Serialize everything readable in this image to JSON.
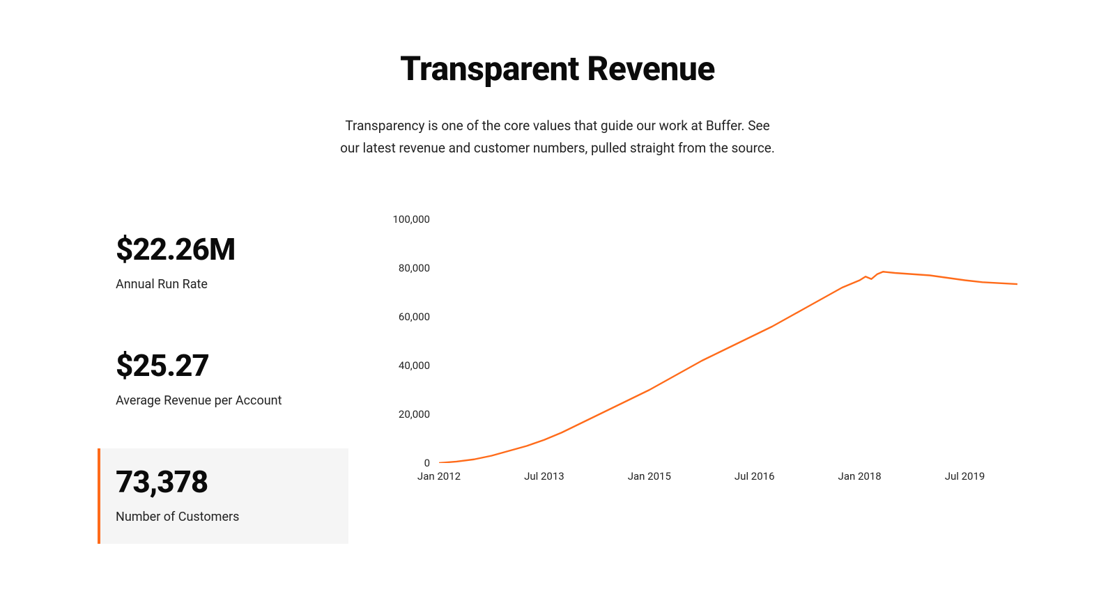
{
  "header": {
    "title": "Transparent Revenue",
    "subtitle": "Transparency is one of the core values that guide our work at Buffer. See our latest revenue and customer numbers, pulled straight from the source."
  },
  "stats": {
    "arr": {
      "value": "$22.26M",
      "label": "Annual Run Rate"
    },
    "arpa": {
      "value": "$25.27",
      "label": "Average Revenue per Account"
    },
    "customers": {
      "value": "73,378",
      "label": "Number of Customers"
    }
  },
  "accent_color": "#ff6b1a",
  "chart_data": {
    "type": "line",
    "title": "",
    "xlabel": "",
    "ylabel": "",
    "ylim": [
      0,
      100000
    ],
    "y_ticks": [
      "0",
      "20,000",
      "40,000",
      "60,000",
      "80,000",
      "100,000"
    ],
    "x_ticks": [
      "Jan 2012",
      "Jul 2013",
      "Jan 2015",
      "Jul 2016",
      "Jan 2018",
      "Jul 2019"
    ],
    "series": [
      {
        "name": "Number of Customers",
        "color": "#ff6b1a",
        "points": [
          {
            "x": "Jan 2012",
            "y": 0
          },
          {
            "x": "Apr 2012",
            "y": 600
          },
          {
            "x": "Jul 2012",
            "y": 1500
          },
          {
            "x": "Oct 2012",
            "y": 3000
          },
          {
            "x": "Jan 2013",
            "y": 5000
          },
          {
            "x": "Apr 2013",
            "y": 7000
          },
          {
            "x": "Jul 2013",
            "y": 9500
          },
          {
            "x": "Oct 2013",
            "y": 12500
          },
          {
            "x": "Jan 2014",
            "y": 16000
          },
          {
            "x": "Apr 2014",
            "y": 19500
          },
          {
            "x": "Jul 2014",
            "y": 23000
          },
          {
            "x": "Oct 2014",
            "y": 26500
          },
          {
            "x": "Jan 2015",
            "y": 30000
          },
          {
            "x": "Apr 2015",
            "y": 34000
          },
          {
            "x": "Jul 2015",
            "y": 38000
          },
          {
            "x": "Oct 2015",
            "y": 42000
          },
          {
            "x": "Jan 2016",
            "y": 45500
          },
          {
            "x": "Apr 2016",
            "y": 49000
          },
          {
            "x": "Jul 2016",
            "y": 52500
          },
          {
            "x": "Oct 2016",
            "y": 56000
          },
          {
            "x": "Jan 2017",
            "y": 60000
          },
          {
            "x": "Apr 2017",
            "y": 64000
          },
          {
            "x": "Jul 2017",
            "y": 68000
          },
          {
            "x": "Oct 2017",
            "y": 72000
          },
          {
            "x": "Jan 2018",
            "y": 75000
          },
          {
            "x": "Feb 2018",
            "y": 76500
          },
          {
            "x": "Mar 2018",
            "y": 75500
          },
          {
            "x": "Apr 2018",
            "y": 77500
          },
          {
            "x": "May 2018",
            "y": 78500
          },
          {
            "x": "Jul 2018",
            "y": 78000
          },
          {
            "x": "Oct 2018",
            "y": 77500
          },
          {
            "x": "Jan 2019",
            "y": 77000
          },
          {
            "x": "Apr 2019",
            "y": 76000
          },
          {
            "x": "Jul 2019",
            "y": 75000
          },
          {
            "x": "Oct 2019",
            "y": 74200
          },
          {
            "x": "Apr 2020",
            "y": 73400
          }
        ]
      }
    ]
  }
}
